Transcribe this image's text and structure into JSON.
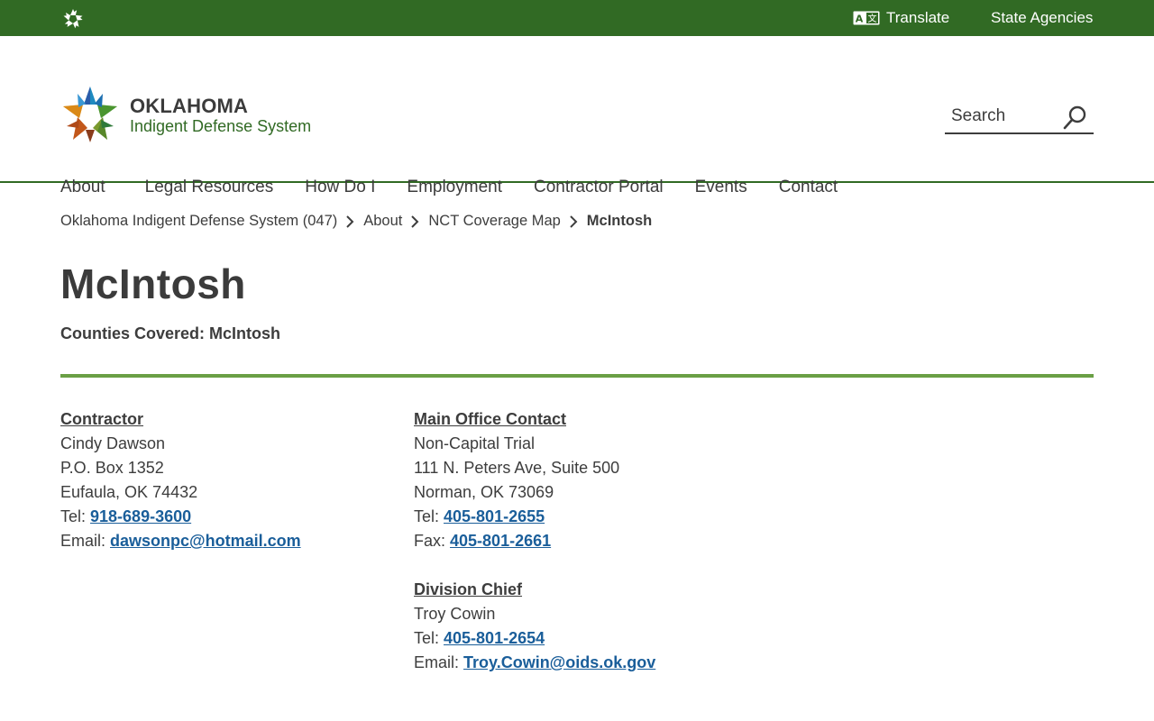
{
  "topbar": {
    "translate_label": "Translate",
    "agencies_label": "State Agencies"
  },
  "logo": {
    "line1": "OKLAHOMA",
    "line2": "Indigent Defense System"
  },
  "search": {
    "placeholder": "Search"
  },
  "nav": {
    "items": [
      {
        "label": "About"
      },
      {
        "label": "Legal Resources"
      },
      {
        "label": "How Do I"
      },
      {
        "label": "Employment"
      },
      {
        "label": "Contractor Portal"
      },
      {
        "label": "Events"
      },
      {
        "label": "Contact"
      }
    ]
  },
  "breadcrumb": {
    "items": [
      {
        "label": "Oklahoma Indigent Defense System (047)"
      },
      {
        "label": "About"
      },
      {
        "label": "NCT Coverage Map"
      }
    ],
    "current": "McIntosh"
  },
  "page": {
    "title": "McIntosh",
    "counties": "Counties Covered: McIntosh"
  },
  "contractor": {
    "heading": "Contractor",
    "name": "Cindy Dawson",
    "address1": "P.O. Box 1352",
    "address2": "Eufaula, OK 74432",
    "tel_label": "Tel: ",
    "tel": "918-689-3600",
    "email_label": "Email: ",
    "email": "dawsonpc@hotmail.com"
  },
  "main_office": {
    "heading": "Main Office Contact",
    "name": "Non-Capital Trial",
    "address1": "111 N. Peters Ave, Suite 500",
    "address2": "Norman, OK 73069",
    "tel_label": "Tel: ",
    "tel": "405-801-2655",
    "fax_label": "Fax: ",
    "fax": "405-801-2661"
  },
  "division_chief": {
    "heading": "Division Chief",
    "name": "Troy Cowin",
    "tel_label": "Tel: ",
    "tel": "405-801-2654",
    "email_label": "Email: ",
    "email": "Troy.Cowin@oids.ok.gov"
  },
  "colors": {
    "topbar": "#316a24",
    "rule": "#6a9f45",
    "link": "#1a5e9a"
  },
  "icons": [
    "ok-star-icon",
    "translate-icon",
    "search-icon",
    "chevron-right-icon"
  ]
}
